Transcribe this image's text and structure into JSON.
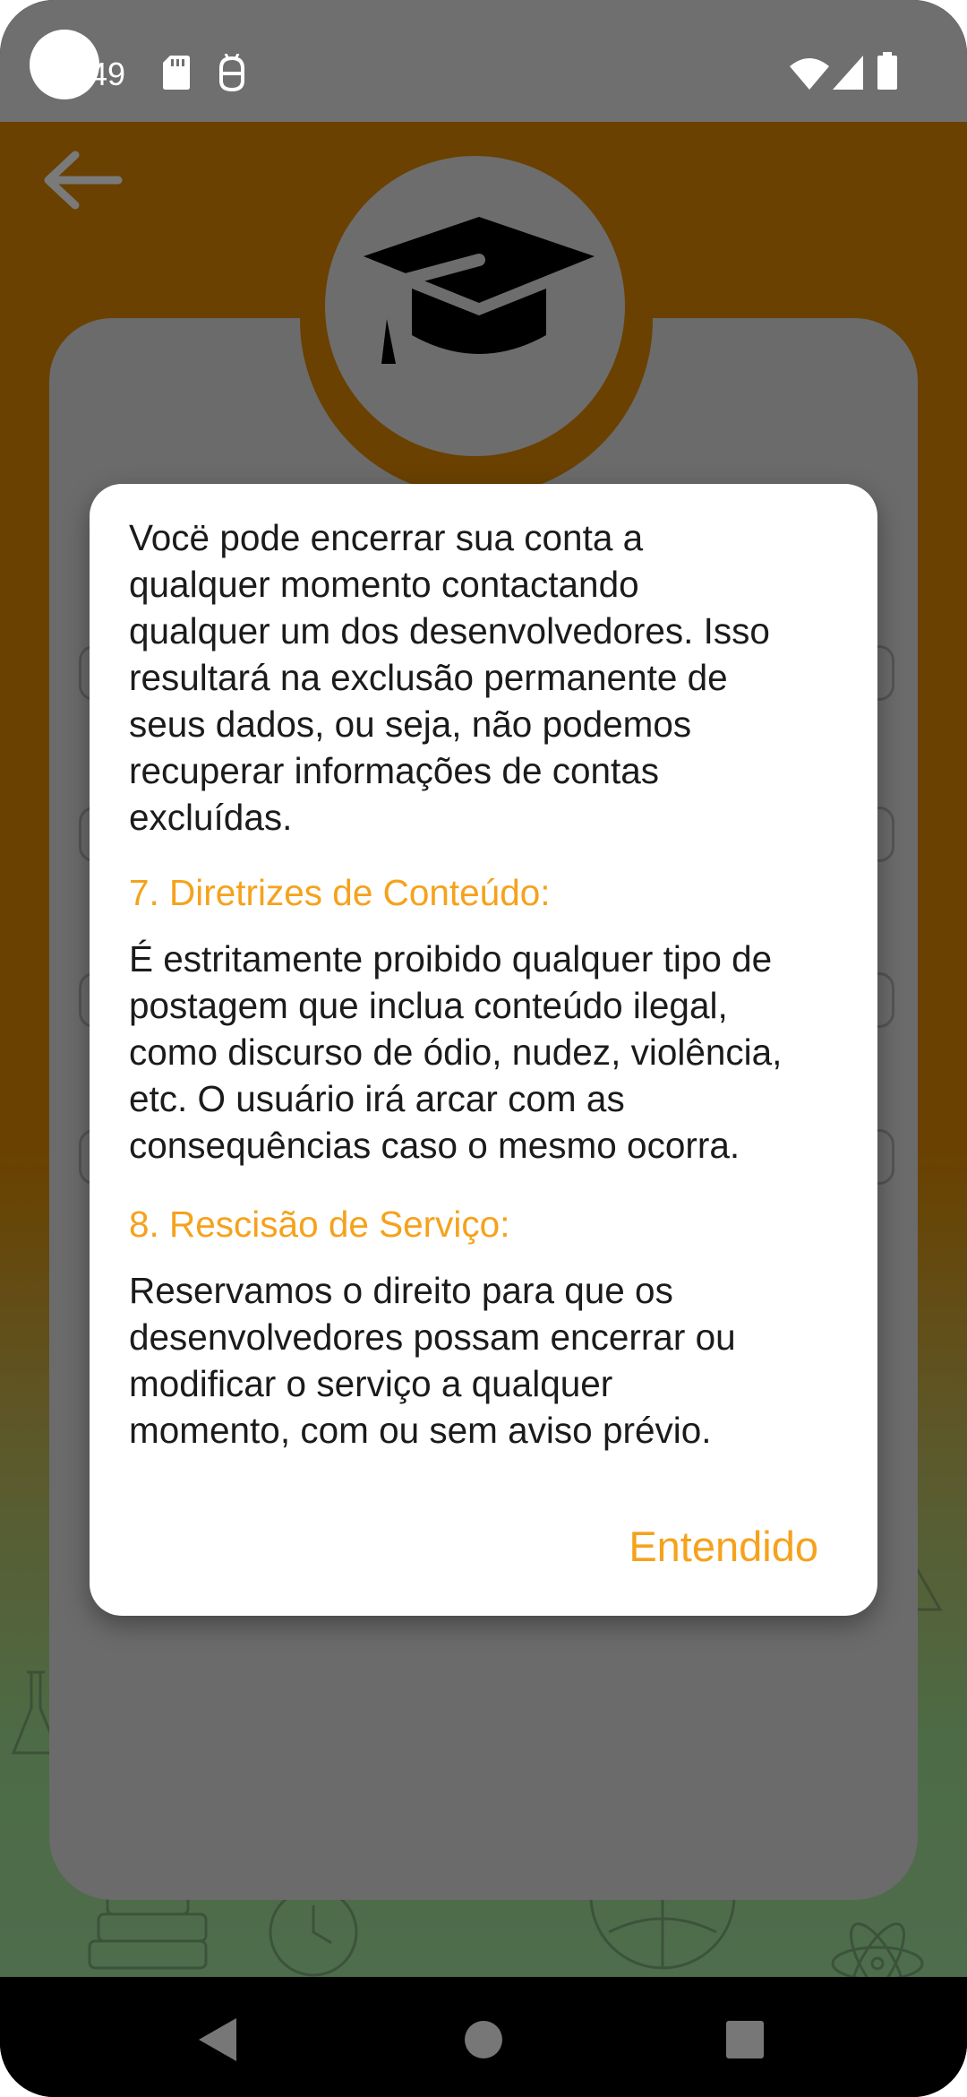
{
  "status_bar": {
    "time": "49",
    "icons": [
      "sd-card-icon",
      "android-debug-icon",
      "wifi-icon",
      "signal-icon",
      "battery-icon"
    ]
  },
  "header": {
    "back_icon": "arrow-left-icon",
    "avatar_icon": "graduation-cap-icon"
  },
  "dialog": {
    "paragraph_1": "Vocë pode encerrar sua conta a\nqualquer momento contactando\nqualquer um dos desenvolvedores. Isso\nresultará na exclusão permanente de\nseus dados, ou seja, não podemos\nrecuperar informações de contas\nexcluídas.",
    "heading_7": "7. Diretrizes de Conteúdo:",
    "paragraph_7": "É estritamente proibido qualquer tipo de\npostagem que inclua conteúdo ilegal,\ncomo discurso de ódio, nudez, violência,\netc. O usuário irá arcar com as\nconsequências caso o mesmo ocorra.",
    "heading_8": "8. Rescisão de Serviço:",
    "paragraph_8": "Reservamos o direito para que os\ndesenvolvedores possam encerrar ou\nmodificar o serviço a qualquer\nmomento, com ou sem aviso prévio.",
    "ok_label": "Entendido"
  },
  "navigation_bar": {
    "icons": [
      "nav-back-icon",
      "nav-home-icon",
      "nav-recents-icon"
    ]
  },
  "colors": {
    "accent": "#f5a21c",
    "header_brown": "#6a4100",
    "scrim_gray": "#6b6b6b"
  }
}
